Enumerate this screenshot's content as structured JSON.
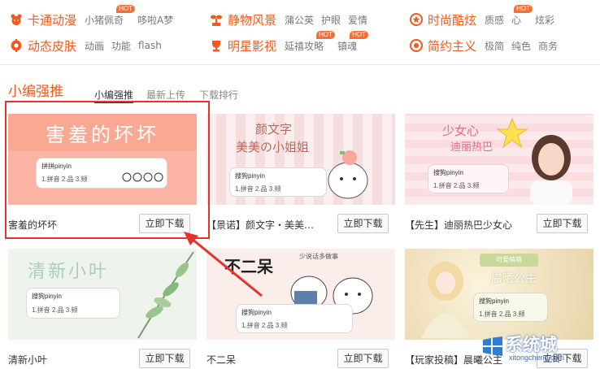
{
  "nav": {
    "groups": [
      {
        "title": "卡通动漫",
        "links": [
          {
            "label": "小猪佩奇",
            "hot": true
          },
          {
            "label": "哆啦A梦",
            "hot": false
          }
        ]
      },
      {
        "title": "动态皮肤",
        "links": [
          {
            "label": "动画",
            "hot": false
          },
          {
            "label": "功能",
            "hot": false
          },
          {
            "label": "flash",
            "hot": false
          }
        ]
      },
      {
        "title": "静物风景",
        "links": [
          {
            "label": "蒲公英",
            "hot": false
          },
          {
            "label": "护眼",
            "hot": false
          },
          {
            "label": "爱情",
            "hot": false
          }
        ]
      },
      {
        "title": "明星影视",
        "links": [
          {
            "label": "延禧攻略",
            "hot": true
          },
          {
            "label": "镇魂",
            "hot": true
          }
        ]
      },
      {
        "title": "时尚酷炫",
        "links": [
          {
            "label": "质感",
            "hot": false
          },
          {
            "label": "心",
            "hot": true
          },
          {
            "label": "炫彩",
            "hot": false
          }
        ]
      },
      {
        "title": "简约主义",
        "links": [
          {
            "label": "极简",
            "hot": false
          },
          {
            "label": "纯色",
            "hot": false
          },
          {
            "label": "商务",
            "hot": false
          }
        ]
      }
    ],
    "hot_badge": "HOT"
  },
  "section": {
    "title": "小编强推",
    "tabs": [
      "小编强推",
      "最新上传",
      "下载排行"
    ]
  },
  "download_label": "立即下载",
  "cards": [
    {
      "name": "害羞的坏坏",
      "art_title": "害羞的坏坏",
      "input": "拼拼pinyin",
      "cands": "1.拼音 2.品 3.频"
    },
    {
      "name": "【景诺】颜文字・美美…",
      "art_title": "颜文字",
      "art_sub": "美美の小姐姐",
      "input": "搜狗pinyin",
      "cands": "1.拼音 2.品 3.频"
    },
    {
      "name": "【先生】迪丽热巴少女心",
      "art_title": "少女心",
      "art_sub": "迪丽热巴",
      "input": "搜狗pinyin",
      "cands": "1.拼音 2.品 3.频"
    },
    {
      "name": "清新小叶",
      "art_title": "清新小叶",
      "input": "搜狗pinyin",
      "cands": "1.拼音 2.品 3.频"
    },
    {
      "name": "不二呆",
      "art_title": "不二呆",
      "art_sub": "少说话多做事",
      "input": "搜狗pinyin",
      "cands": "1.拼音 2.品 3.频"
    },
    {
      "name": "【玩家投稿】晨曦公主",
      "art_title": "晨曦公主",
      "art_sub": "可爱萌萌",
      "input": "搜狗pinyin",
      "cands": "1.拼音 2.品 3.频"
    }
  ],
  "watermark": {
    "text": "系统城",
    "sub": "xitongcheng.com"
  },
  "colors": {
    "accent": "#f05a1e",
    "highlight": "#e5322d"
  }
}
